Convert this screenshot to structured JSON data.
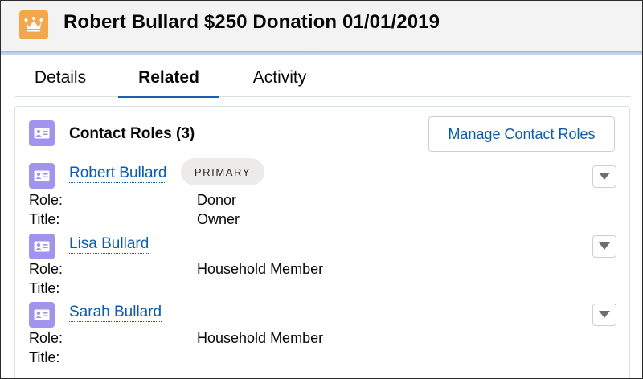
{
  "header": {
    "title": "Robert Bullard $250 Donation 01/01/2019",
    "icon": "crown-icon",
    "icon_color": "#f4a74a"
  },
  "tabs": [
    {
      "label": "Details",
      "active": false
    },
    {
      "label": "Related",
      "active": true
    },
    {
      "label": "Activity",
      "active": false
    }
  ],
  "contact_roles": {
    "title": "Contact Roles (3)",
    "icon": "contact-card-icon",
    "icon_color": "#a094ed",
    "manage_label": "Manage Contact Roles",
    "role_label": "Role:",
    "title_label": "Title:",
    "contacts": [
      {
        "name": "Robert Bullard",
        "badge": "PRIMARY",
        "role": "Donor",
        "title": "Owner"
      },
      {
        "name": "Lisa Bullard",
        "role": "Household Member",
        "title": ""
      },
      {
        "name": "Sarah Bullard",
        "role": "Household Member",
        "title": ""
      }
    ]
  },
  "colors": {
    "link": "#0b5cab",
    "active_tab_underline": "#1b5fb0"
  }
}
